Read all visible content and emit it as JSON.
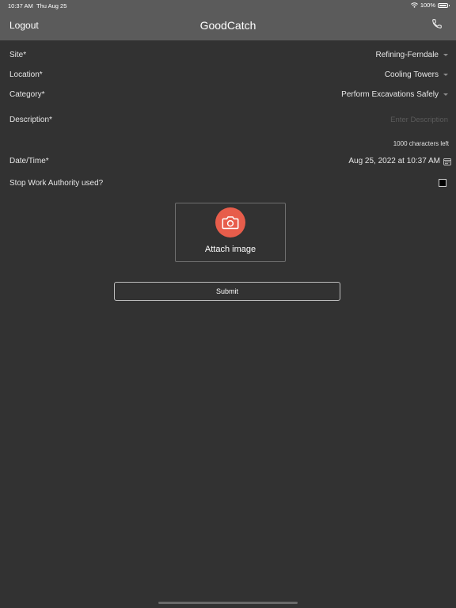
{
  "status_bar": {
    "time": "10:37 AM",
    "date": "Thu Aug 25",
    "battery": "100%"
  },
  "nav": {
    "logout_label": "Logout",
    "title": "GoodCatch"
  },
  "form": {
    "site": {
      "label": "Site*",
      "value": "Refining-Ferndale"
    },
    "location": {
      "label": "Location*",
      "value": "Cooling Towers"
    },
    "category": {
      "label": "Category*",
      "value": "Perform Excavations Safely"
    },
    "description": {
      "label": "Description*",
      "placeholder": "Enter Description",
      "value": "",
      "chars_left": "1000 characters left"
    },
    "datetime": {
      "label": "Date/Time*",
      "value": "Aug 25, 2022 at 10:37 AM"
    },
    "stop_work": {
      "label": "Stop Work Authority used?",
      "checked": false
    }
  },
  "attach": {
    "label": "Attach image"
  },
  "submit": {
    "label": "Submit"
  },
  "colors": {
    "background": "#323232",
    "nav_bar": "#5b5b5b",
    "accent_camera": "#e75d4b"
  },
  "icons": {
    "phone": "phone-icon",
    "camera": "camera-icon",
    "calendar": "calendar-icon",
    "wifi": "wifi-icon",
    "battery": "battery-icon"
  }
}
